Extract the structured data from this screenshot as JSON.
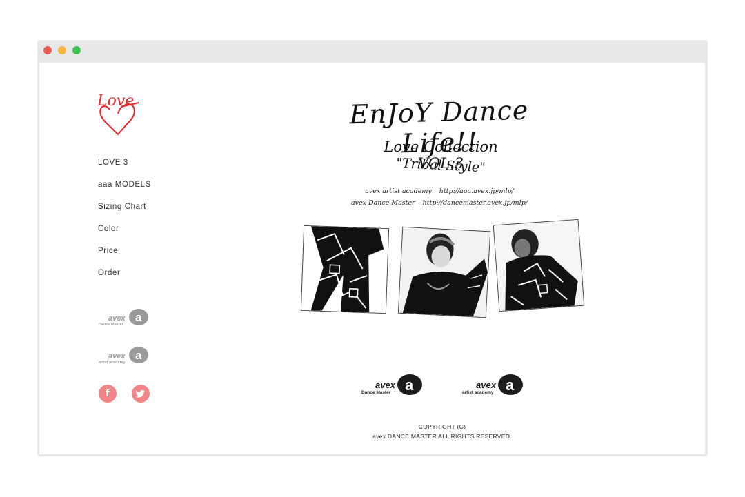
{
  "nav": {
    "items": [
      {
        "label": "LOVE 3"
      },
      {
        "label": "aaa MODELS"
      },
      {
        "label": "Sizing Chart"
      },
      {
        "label": "Color"
      },
      {
        "label": "Price"
      },
      {
        "label": "Order"
      }
    ]
  },
  "brand": {
    "logo_text": "Love",
    "accent_color": "#e8232a",
    "social_color": "#f28585"
  },
  "sidebar_logos": [
    {
      "word": "avex",
      "sub": "Dance Master",
      "icon": "avex-a-logo"
    },
    {
      "word": "avex",
      "sub": "artist academy",
      "icon": "avex-a-logo"
    }
  ],
  "social": {
    "facebook": {
      "icon": "facebook-icon",
      "glyph": "f"
    },
    "twitter": {
      "icon": "twitter-icon",
      "glyph": "🐦"
    }
  },
  "hero": {
    "title": "EnJoY Dance Life!!",
    "subtitle": "Love Collection  VOL.3",
    "tagline": "\"Tribal Style\""
  },
  "links": [
    {
      "name": "avex artist academy",
      "url": "http://aaa.avex.jp/mlp/"
    },
    {
      "name": "avex Dance Master",
      "url": "http://dancemaster.avex.jp/mlp/"
    }
  ],
  "footer": {
    "logos": [
      {
        "word": "avex",
        "sub": "Dance Master"
      },
      {
        "word": "avex",
        "sub": "artist academy"
      }
    ],
    "copyright_line1": "COPYRIGHT (C)",
    "copyright_line2": "avex DANCE MASTER ALL RIGHTS RESERVED."
  }
}
